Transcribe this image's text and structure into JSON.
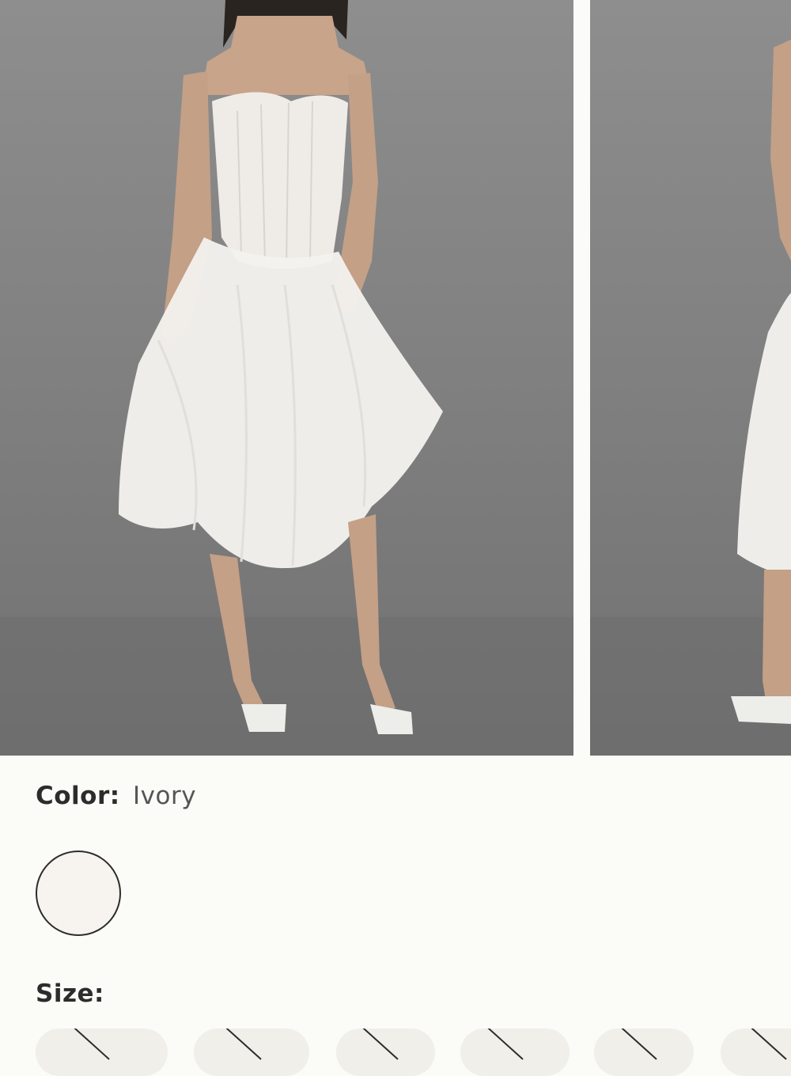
{
  "gallery": {
    "images": [
      {
        "name": "model-front-view"
      },
      {
        "name": "model-alt-view"
      }
    ]
  },
  "color": {
    "label": "Color:",
    "value": "Ivory",
    "swatch_hex": "#f7f3ef"
  },
  "size": {
    "label": "Size:",
    "options": [
      {
        "label": "",
        "available": false
      },
      {
        "label": "",
        "available": false
      },
      {
        "label": "",
        "available": false
      },
      {
        "label": "",
        "available": false
      },
      {
        "label": "",
        "available": false
      },
      {
        "label": "",
        "available": false
      }
    ]
  },
  "colors": {
    "background": "#fbfbf8",
    "studio_backdrop": "#808080",
    "text": "#2b2b2b",
    "chip": "#f0efea"
  }
}
